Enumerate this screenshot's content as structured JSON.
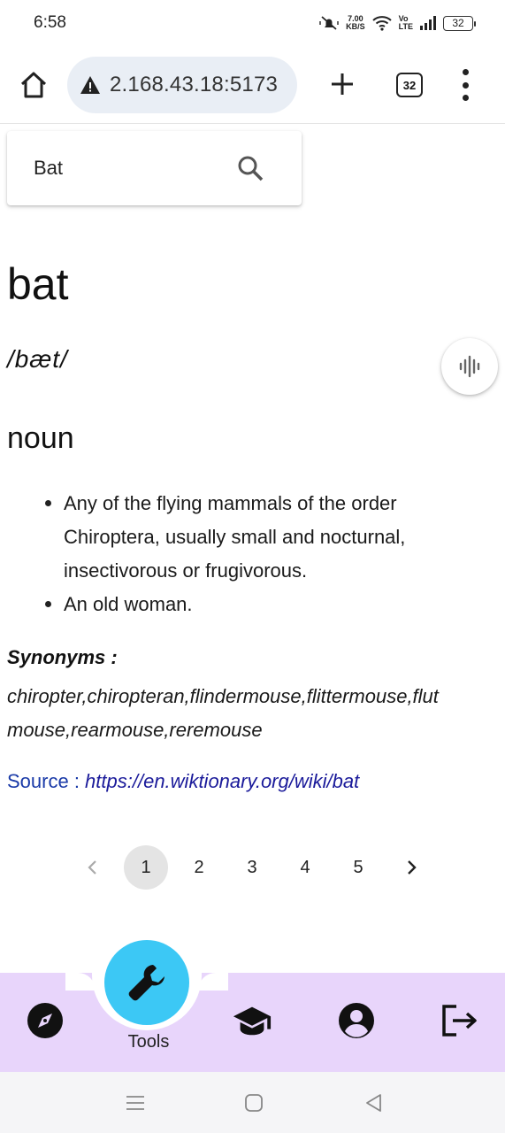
{
  "status_bar": {
    "time": "6:58",
    "net_speed_value": "7.00",
    "net_speed_unit": "KB/S",
    "volte_top": "Vo",
    "volte_bottom": "LTE",
    "battery": "32"
  },
  "browser": {
    "url": "2.168.43.18:5173",
    "tab_count": "32"
  },
  "search": {
    "value": "Bat"
  },
  "entry": {
    "word": "bat",
    "phonetic": "/bæt/",
    "part_of_speech": "noun",
    "definitions": [
      "Any of the flying mammals of the order Chiroptera, usually small and nocturnal, insectivorous or frugivorous.",
      "An old woman."
    ],
    "synonyms_label": "Synonyms :",
    "synonyms_line1": "chiropter,chiropteran,flindermouse,flittermouse,flut",
    "synonyms_line2": "mouse,rearmouse,reremouse",
    "source_label": "Source : ",
    "source_url": "https://en.wiktionary.org/wiki/bat"
  },
  "pagination": {
    "pages": [
      "1",
      "2",
      "3",
      "4",
      "5"
    ],
    "current": "1"
  },
  "bottom_nav": {
    "active_label": "Tools"
  },
  "colors": {
    "bottom_nav_bg": "#e8d5fb",
    "fab": "#3cc8f5",
    "link": "#1a1a9a",
    "url_pill": "#e9eef5"
  }
}
